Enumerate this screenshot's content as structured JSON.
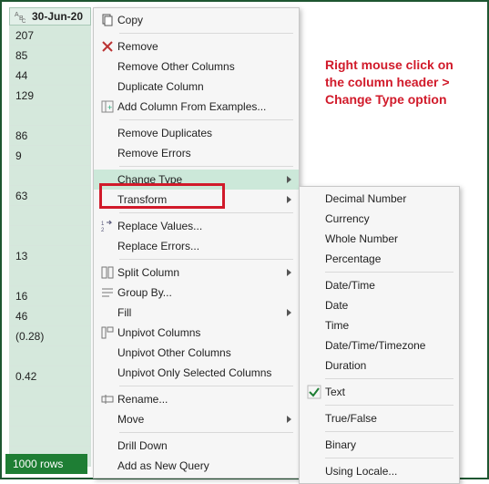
{
  "column": {
    "header": "30-Jun-20"
  },
  "cells": [
    "207",
    "85",
    "44",
    "129",
    "",
    "86",
    "9",
    "",
    "63",
    "",
    "",
    "13",
    "",
    "16",
    "46",
    "(0.28)",
    "",
    "0.42",
    "",
    "",
    "",
    ""
  ],
  "status": {
    "text": "1000 rows"
  },
  "menu": {
    "copy": "Copy",
    "remove": "Remove",
    "removeOther": "Remove Other Columns",
    "duplicate": "Duplicate Column",
    "addFromExamples": "Add Column From Examples...",
    "removeDup": "Remove Duplicates",
    "removeErr": "Remove Errors",
    "changeType": "Change Type",
    "transform": "Transform",
    "replaceVal": "Replace Values...",
    "replaceErr": "Replace Errors...",
    "splitCol": "Split Column",
    "groupBy": "Group By...",
    "fill": "Fill",
    "unpivot": "Unpivot Columns",
    "unpivotOther": "Unpivot Other Columns",
    "unpivotSel": "Unpivot Only Selected Columns",
    "rename": "Rename...",
    "move": "Move",
    "drillDown": "Drill Down",
    "addQuery": "Add as New Query"
  },
  "submenu": {
    "decimal": "Decimal Number",
    "currency": "Currency",
    "whole": "Whole Number",
    "percentage": "Percentage",
    "datetime": "Date/Time",
    "date": "Date",
    "time": "Time",
    "dttz": "Date/Time/Timezone",
    "duration": "Duration",
    "text": "Text",
    "truefalse": "True/False",
    "binary": "Binary",
    "locale": "Using Locale..."
  },
  "annotation": "Right mouse click on the column header > Change Type option"
}
